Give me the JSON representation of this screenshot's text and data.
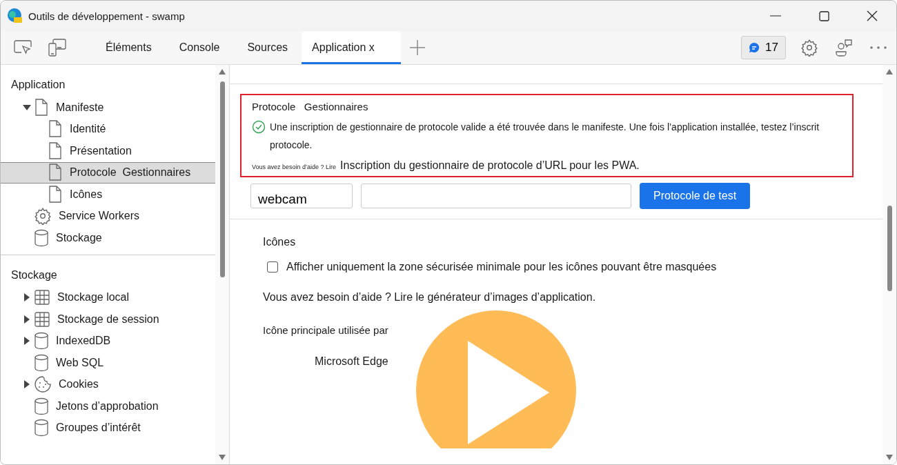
{
  "window": {
    "title": "Outils de développement - swamp"
  },
  "tabs": [
    {
      "label": "Éléments",
      "selected": false
    },
    {
      "label": "Console",
      "selected": false
    },
    {
      "label": "Sources",
      "selected": false
    },
    {
      "label": "Application x",
      "selected": true
    }
  ],
  "issues_badge": {
    "count": "17"
  },
  "sidebar": {
    "sections": [
      {
        "title": "Application",
        "items": [
          {
            "label": "Manifeste",
            "kind": "file",
            "expanded": true,
            "selected": false,
            "children": [
              {
                "label": "Identité",
                "kind": "file",
                "selected": false
              },
              {
                "label": "Présentation",
                "kind": "file",
                "selected": false
              },
              {
                "label": "Protocole  Gestionnaires",
                "kind": "file",
                "selected": true
              },
              {
                "label": "Icônes",
                "kind": "file",
                "selected": false
              }
            ]
          },
          {
            "label": "Service Workers",
            "kind": "gear",
            "selected": false
          },
          {
            "label": "Stockage",
            "kind": "database",
            "selected": false
          }
        ]
      },
      {
        "title": "Stockage",
        "items": [
          {
            "label": "Stockage local",
            "kind": "grid",
            "expanded": false,
            "selected": false
          },
          {
            "label": "Stockage de session",
            "kind": "grid",
            "expanded": false,
            "selected": false
          },
          {
            "label": "IndexedDB",
            "kind": "database",
            "expanded": false,
            "selected": false
          },
          {
            "label": "Web SQL",
            "kind": "database",
            "selected": false
          },
          {
            "label": "Cookies",
            "kind": "cookie",
            "expanded": false,
            "selected": false
          },
          {
            "label": "Jetons d’approbation",
            "kind": "database",
            "selected": false
          },
          {
            "label": "Groupes d’intérêt",
            "kind": "database",
            "selected": false
          }
        ]
      }
    ]
  },
  "protocol_section": {
    "title": "Protocole   Gestionnaires",
    "highlighted": true,
    "status_lines": [
      "Une inscription de gestionnaire de protocole valide a été trouvée dans le manifeste. Une fois l’application installée, testez l’inscrit",
      "protocole."
    ],
    "help_prefix": "Vous avez besoin d’aide ? Lire",
    "help_link": "Inscription du gestionnaire de protocole d’URL pour les PWA.",
    "protocol_value": "webcam",
    "button": "Protocole de test"
  },
  "icons_section": {
    "title": "Icônes",
    "checkbox": {
      "label": "Afficher uniquement la zone sécurisée minimale pour les icônes pouvant être masquées",
      "checked": false
    },
    "help": "Vous avez besoin d’aide ? Lire le générateur d’images d’application.",
    "primary_label": "Icône principale utilisée par",
    "browser": "Microsoft Edge"
  }
}
